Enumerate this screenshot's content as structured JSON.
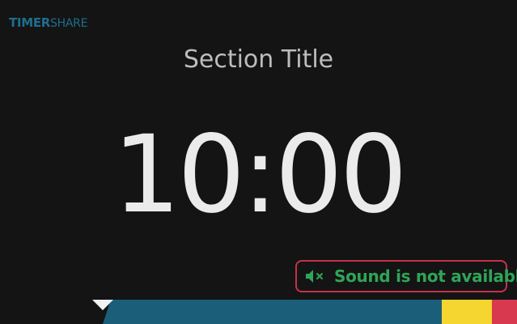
{
  "app": {
    "logo_bold": "TIMER",
    "logo_light": "SHARE",
    "brand_color": "#1d6f8e"
  },
  "timer": {
    "section_title": "Section Title",
    "time": "10:00"
  },
  "notice": {
    "icon": "speaker-muted-icon",
    "text": "Sound is not available",
    "text_color": "#2fa558",
    "border_color": "#c4334a"
  },
  "progress": {
    "colors": {
      "main": "#1a5e7a",
      "warning": "#f5d530",
      "danger": "#d9394e",
      "marker": "#f2f2f2"
    }
  }
}
